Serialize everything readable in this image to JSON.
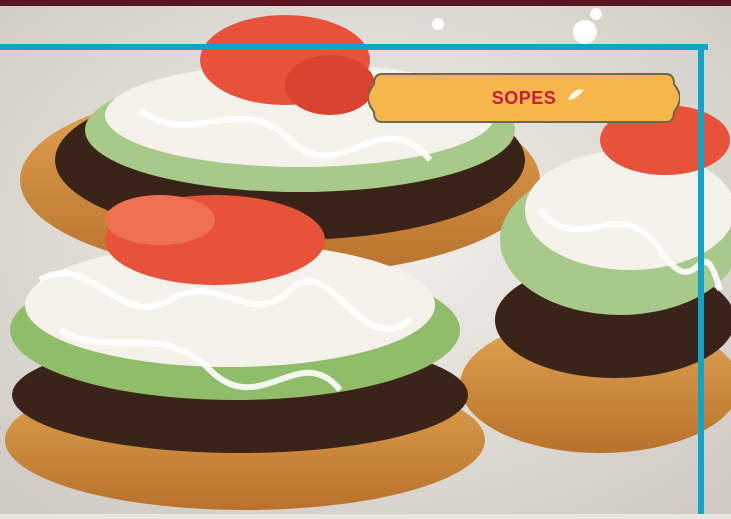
{
  "banner": {
    "label": "SOPES"
  },
  "colors": {
    "frame": "#13a3c9",
    "topbar": "#5a1620",
    "banner_fill": "#f6b64b",
    "banner_stroke": "#6b6a4a",
    "banner_text": "#c4203a"
  },
  "icons": {
    "banner_decoration": "leaf-icon"
  }
}
